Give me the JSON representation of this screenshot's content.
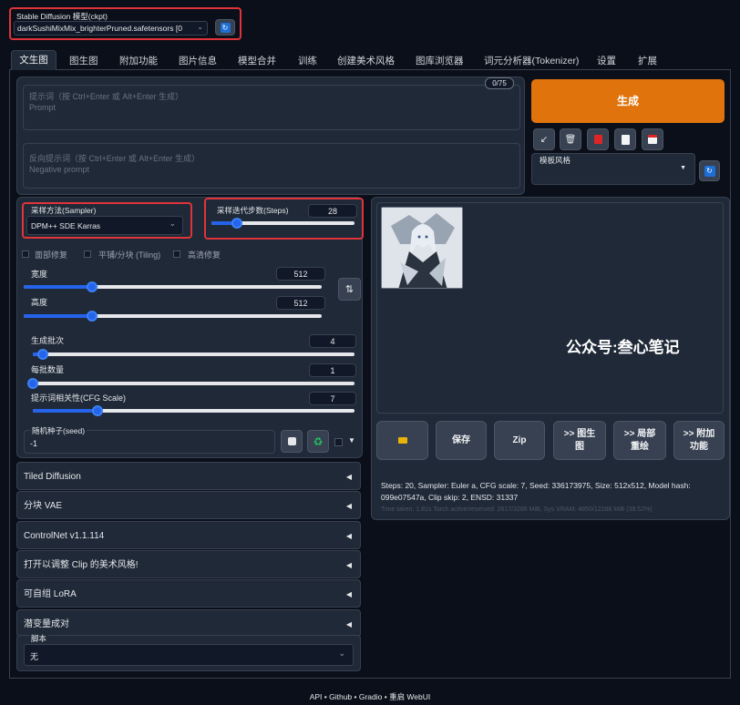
{
  "checkpoint": {
    "label": "Stable Diffusion 模型(ckpt)",
    "value": "darkSushiMixMix_brighterPruned.safetensors [0"
  },
  "tabs": [
    "文生图",
    "图生图",
    "附加功能",
    "图片信息",
    "模型合并",
    "训练",
    "创建美术风格",
    "图库浏览器",
    "词元分析器(Tokenizer)",
    "设置",
    "扩展"
  ],
  "prompt": {
    "counter": "0/75",
    "placeholder_line1": "提示词（按 Ctrl+Enter 或 Alt+Enter 生成）",
    "placeholder_line2": "Prompt"
  },
  "negative": {
    "placeholder_line1": "反向提示词（按 Ctrl+Enter 或 Alt+Enter 生成）",
    "placeholder_line2": "Negative prompt"
  },
  "generate": {
    "label": "生成",
    "color": "#e0730c"
  },
  "style": {
    "label": "模板风格"
  },
  "sampler": {
    "label": "采样方法(Sampler)",
    "value": "DPM++ SDE Karras"
  },
  "steps": {
    "label": "采样迭代步数(Steps)",
    "value": "28",
    "fraction": 0.18
  },
  "checkboxes": [
    "面部修复",
    "平铺/分块 (Tiling)",
    "高清修复"
  ],
  "width": {
    "label": "宽度",
    "value": "512",
    "fraction": 0.23
  },
  "height": {
    "label": "高度",
    "value": "512",
    "fraction": 0.23
  },
  "batch_count": {
    "label": "生成批次",
    "value": "4",
    "fraction": 0.03
  },
  "batch_size": {
    "label": "每批数量",
    "value": "1",
    "fraction": 0.0
  },
  "cfg": {
    "label": "提示词相关性(CFG Scale)",
    "value": "7",
    "fraction": 0.2
  },
  "seed": {
    "label": "随机种子(seed)",
    "value": "-1"
  },
  "accordions": [
    "Tiled Diffusion",
    "分块 VAE",
    "ControlNet v1.1.114",
    "打开以调整 Clip 的美术风格!",
    "可自组 LoRA",
    "潜变量成对"
  ],
  "script": {
    "label": "脚本",
    "value": "无"
  },
  "watermark": "公众号:叁心笔记",
  "gallery_buttons": [
    "保存",
    "Zip",
    ">> 图生图",
    ">> 局部重绘",
    ">> 附加功能"
  ],
  "info": {
    "line1": "Steps: 20, Sampler: Euler a, CFG scale: 7, Seed: 336173975, Size: 512x512, Model hash:",
    "line2": "099e07547a, Clip skip: 2, ENSD: 31337",
    "line3": "Time taken: 1.81s  Torch active/reserved: 2617/3286 MiB, Sys VRAM: 4850/12288 MiB (39.52%)"
  },
  "footer": "API  •  Github  •  Gradio  •  重启 WebUI"
}
